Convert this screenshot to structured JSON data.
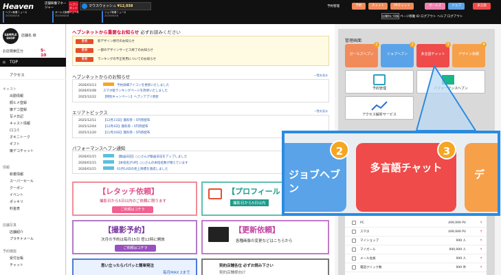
{
  "header": {
    "logo": "Heaven",
    "logo_sub": "店舗稼働マネージャー",
    "brand_badge": "ヘブンネット",
    "promo_label": "マウスウォッシュ",
    "promo_number": "¥12,038",
    "news": [
      {
        "label": "ヘブン新着ニュース",
        "date": "2025/06/18"
      },
      {
        "label": "ガールズ新着ニュース",
        "date": "2025/06/18"
      },
      {
        "label": "ジョブ新着ニュース",
        "date": "2025/06/18"
      }
    ],
    "yoyaku_label": "予約管理",
    "nav_pills": [
      "予約",
      "チャット",
      "PRチャット",
      "ガールズ",
      "ジョブ",
      "多言語"
    ],
    "hist_button": "店舗別に切換",
    "links": "ページ移動 ID ログアウト ヘルプ ログアウト"
  },
  "sidebar": {
    "logo_text": "SAMPLE SHOP",
    "shop_name": "店舗名 様",
    "rank_label": "お店検索区分",
    "rank_value": "S-10 (A-Z)",
    "top": "TOP",
    "access": "アクセス",
    "sections": [
      {
        "title": "キャスト",
        "items": [
          "出勤情報",
          "顔ヒメ登録",
          "嬢デコ登録",
          "写メ日記",
          "キャスト情報",
          "口コミ",
          "オキニトーク",
          "ギフト",
          "嬢デコチャット"
        ]
      },
      {
        "title": "情報",
        "items": [
          "新着情報",
          "スーパーセール",
          "クーポン",
          "イベント",
          "ポッキリ",
          "料金表"
        ]
      },
      {
        "title": "店舗写真",
        "items": [
          "店舗紹介",
          "プラチナメール"
        ]
      },
      {
        "title": "予約機能",
        "items": [
          "受付台帳",
          "チャット"
        ]
      }
    ]
  },
  "main": {
    "important_title": "ヘブンネットから重要なお知らせ",
    "important_sub": "必ずお読みください",
    "important_tag": "重要",
    "important_items": [
      "新デザイン移行のお知らせ",
      "一部のデザインサービス終了のお知らせ",
      "ランキングの不正利用についてのお知らせ"
    ],
    "news_title": "ヘブンネットからのお知らせ",
    "news_items": [
      {
        "date": "2026/01/13",
        "text": "予約詳細アイコンを更新いたしました"
      },
      {
        "date": "2026/01/08",
        "text": "スマホ版ランキングページを改修いたしました"
      },
      {
        "date": "2025/12/22",
        "text": "【特別キャンペーン】ヘブンアプリ更新"
      }
    ],
    "area_title": "エリアトピックス",
    "area_items": [
      {
        "date": "2025/12/11",
        "text": "【12月11日】無料券・5円券配布"
      },
      {
        "date": "2025/12/04",
        "text": "【12月4日】無料券・5円券配布"
      },
      {
        "date": "2025/11/20",
        "text": "【11月20日】無料券・5円券配布"
      }
    ],
    "perf_title": "パフォーマンスヘブン通知",
    "perf_items": [
      {
        "date": "2026/01/15",
        "text": "【動画日記】○○さんが動画日記をアップしました"
      },
      {
        "date": "2026/01/15",
        "text": "【本指名がUP】○○さんの本指名数が増えています"
      },
      {
        "date": "2026/01/15",
        "text": "01月14日の売上目標を達成しました"
      }
    ],
    "more": "一覧を見る",
    "banners": [
      {
        "title": "【レタッチ依頼】",
        "sub": "撮影日から5日以内のご依頼に限ります",
        "btn": "ご依頼はコチラ"
      },
      {
        "title": "【プロフィール",
        "sub": "撮影日から5日以内"
      },
      {
        "title": "【撮影予約】",
        "sub": "次月の予約は毎月15日 昼12時に開放",
        "btn": "ご依頼はコチラ"
      },
      {
        "title": "【更新依頼】",
        "sub": "各種画像の変更などはこちらから"
      },
      {
        "title": "思い立ったらパパッと簡単発注",
        "sub": "毎月MAX 2まで"
      },
      {
        "title": "契約店舗各位 必ずお読み下さい",
        "sub": "契約店舗様向け"
      }
    ]
  },
  "rpanel": {
    "title": "管理画面",
    "tiles": [
      {
        "label": "ガールズヘブン",
        "num": "1",
        "color": "#f28b5a"
      },
      {
        "label": "ジョブヘブン",
        "num": "2",
        "color": "#5aa3e8"
      },
      {
        "label": "多言語チャット",
        "num": "3",
        "color": "#ef4b4b"
      },
      {
        "label": "デザイン依頼",
        "num": "4",
        "color": "#f7a04a"
      }
    ],
    "white_tiles": [
      "予約管理",
      "予約台帳",
      "パフォーマンスヘブン",
      "アクセス解析サービス"
    ],
    "stats": [
      {
        "label": "PC",
        "value": "499,999 PV"
      },
      {
        "label": "スマホ",
        "value": "499,999 PV"
      },
      {
        "label": "マイショップ",
        "value": "999 人"
      },
      {
        "label": "マイガール",
        "value": "999,999 人"
      },
      {
        "label": "メール会員",
        "value": "999 人"
      },
      {
        "label": "電話クリック数",
        "value": "999 件"
      }
    ]
  },
  "zoom": {
    "left_label": "ジョブヘブン",
    "left_num": "2",
    "mid_label": "多言語チャット",
    "mid_num": "3",
    "right_label": "デ"
  }
}
